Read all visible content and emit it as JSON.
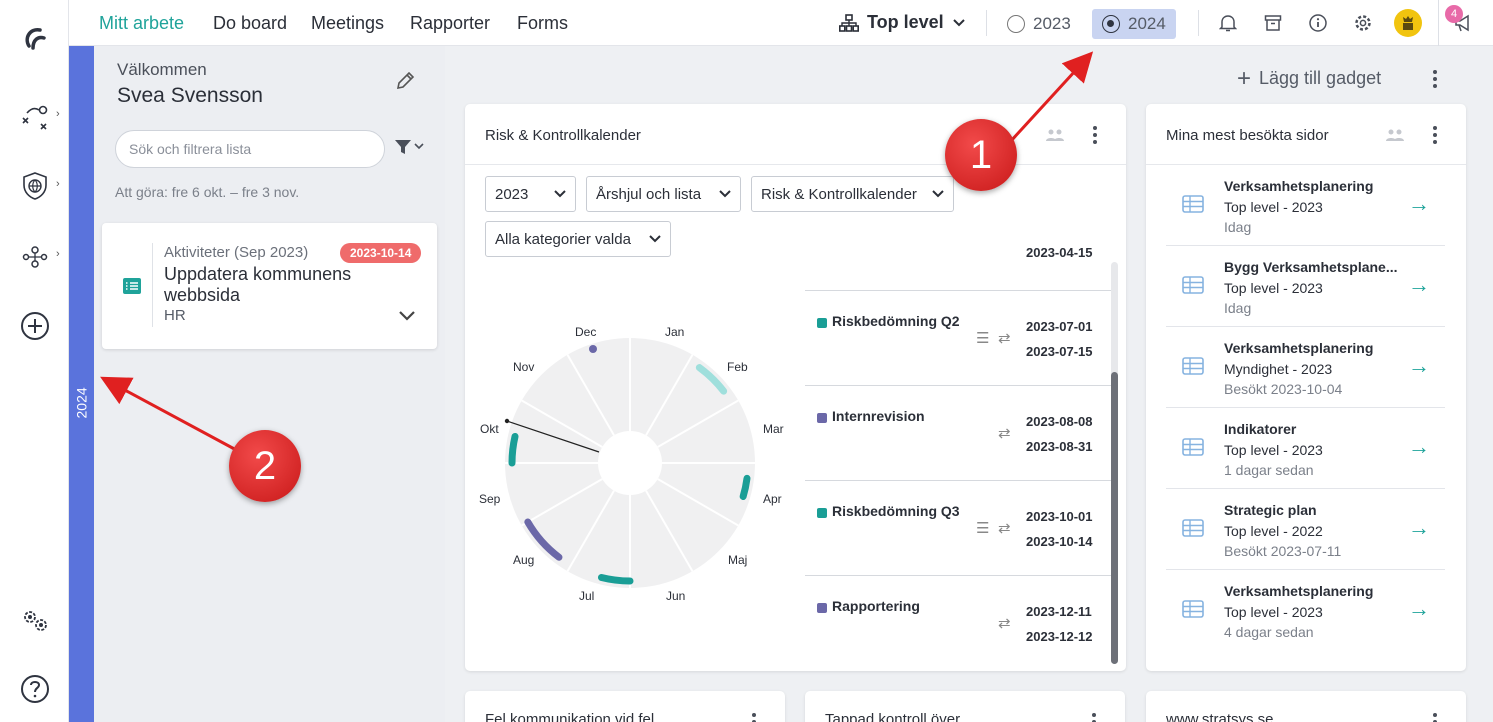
{
  "nav": {
    "tabs": [
      "Mitt arbete",
      "Do board",
      "Meetings",
      "Rapporter",
      "Forms"
    ],
    "org_selector": "Top level",
    "years": [
      "2023",
      "2024"
    ],
    "selected_year": "2024",
    "notification_count": "4"
  },
  "yearbar": {
    "label": "2024"
  },
  "left": {
    "welcome": "Välkommen",
    "user": "Svea Svensson",
    "search_placeholder": "Sök och filtrera lista",
    "todo_range": "Att göra: fre 6 okt. – fre 3 nov.",
    "task": {
      "meta": "Aktiviteter (Sep 2023)",
      "date": "2023-10-14",
      "title": "Uppdatera kommunens webbsida",
      "org": "HR"
    }
  },
  "dashboard": {
    "add_gadget": "Lägg till gadget",
    "risk_card": {
      "title": "Risk & Kontrollkalender",
      "filter_year": "2023",
      "filter_view": "Årshjul och lista",
      "filter_calendar": "Risk & Kontrollkalender",
      "filter_category": "Alla kategorier valda",
      "partial_date": "2023-04-15",
      "months": [
        "Jan",
        "Feb",
        "Mar",
        "Apr",
        "Maj",
        "Jun",
        "Jul",
        "Aug",
        "Sep",
        "Okt",
        "Nov",
        "Dec"
      ],
      "events": [
        {
          "name": "Riskbedömning Q2",
          "start": "2023-07-01",
          "end": "2023-07-15",
          "color": "#1a9e96"
        },
        {
          "name": "Internrevision",
          "start": "2023-08-08",
          "end": "2023-08-31",
          "color": "#6b68a8"
        },
        {
          "name": "Riskbedömning Q3",
          "start": "2023-10-01",
          "end": "2023-10-14",
          "color": "#1a9e96"
        },
        {
          "name": "Rapportering",
          "start": "2023-12-11",
          "end": "2023-12-12",
          "color": "#6b68a8"
        }
      ]
    },
    "visited_card": {
      "title": "Mina mest besökta sidor",
      "items": [
        {
          "title": "Verksamhetsplanering",
          "sub": "Top level - 2023",
          "when": "Idag"
        },
        {
          "title": "Bygg Verksamhetsplane...",
          "sub": "Top level - 2023",
          "when": "Idag"
        },
        {
          "title": "Verksamhetsplanering",
          "sub": "Myndighet - 2023",
          "when": "Besökt 2023-10-04"
        },
        {
          "title": "Indikatorer",
          "sub": "Top level - 2023",
          "when": "1 dagar sedan"
        },
        {
          "title": "Strategic plan",
          "sub": "Top level - 2022",
          "when": "Besökt 2023-07-11"
        },
        {
          "title": "Verksamhetsplanering",
          "sub": "Top level - 2023",
          "when": "4 dagar sedan"
        }
      ]
    },
    "bottom_cards": [
      "Fel kommunikation vid fel",
      "Tappad kontroll över",
      "www.stratsys.se"
    ]
  },
  "callouts": [
    "1",
    "2"
  ],
  "colors": {
    "accent": "#1fa39a",
    "yearbar": "#5a73dc",
    "badge": "#e86aa8",
    "callout": "#d92323"
  }
}
